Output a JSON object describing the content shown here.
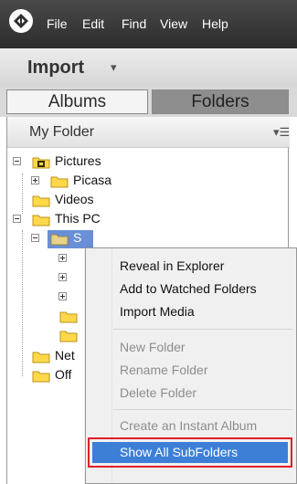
{
  "menubar": {
    "logo_icon": "app-logo-icon",
    "items": [
      "File",
      "Edit",
      "Find",
      "View",
      "Help"
    ]
  },
  "import_bar": {
    "title": "Import",
    "caret_icon": "chevron-down-icon"
  },
  "tabs": {
    "albums": "Albums",
    "folders": "Folders",
    "active": "Folders"
  },
  "panel": {
    "header": "My Folder",
    "menu_icon": "panel-menu-icon",
    "tree": {
      "pictures": "Pictures",
      "picasa": "Picasa",
      "videos": "Videos",
      "this_pc": "This PC",
      "selected": "S",
      "net_partial": "Net",
      "off_partial": "Off"
    }
  },
  "context_menu": {
    "reveal": "Reveal in Explorer",
    "add_watched": "Add to Watched Folders",
    "import_media": "Import Media",
    "new_folder": "New Folder",
    "rename_folder": "Rename Folder",
    "delete_folder": "Delete Folder",
    "create_album": "Create an Instant Album",
    "show_all": "Show All SubFolders"
  },
  "colors": {
    "menubar": "#3a3a3a",
    "folder_tab_active": "#8e8e8e",
    "highlight_border": "#e0202a",
    "highlight_fill": "#3d7fd7",
    "folder_icon": "#ffd84a"
  }
}
